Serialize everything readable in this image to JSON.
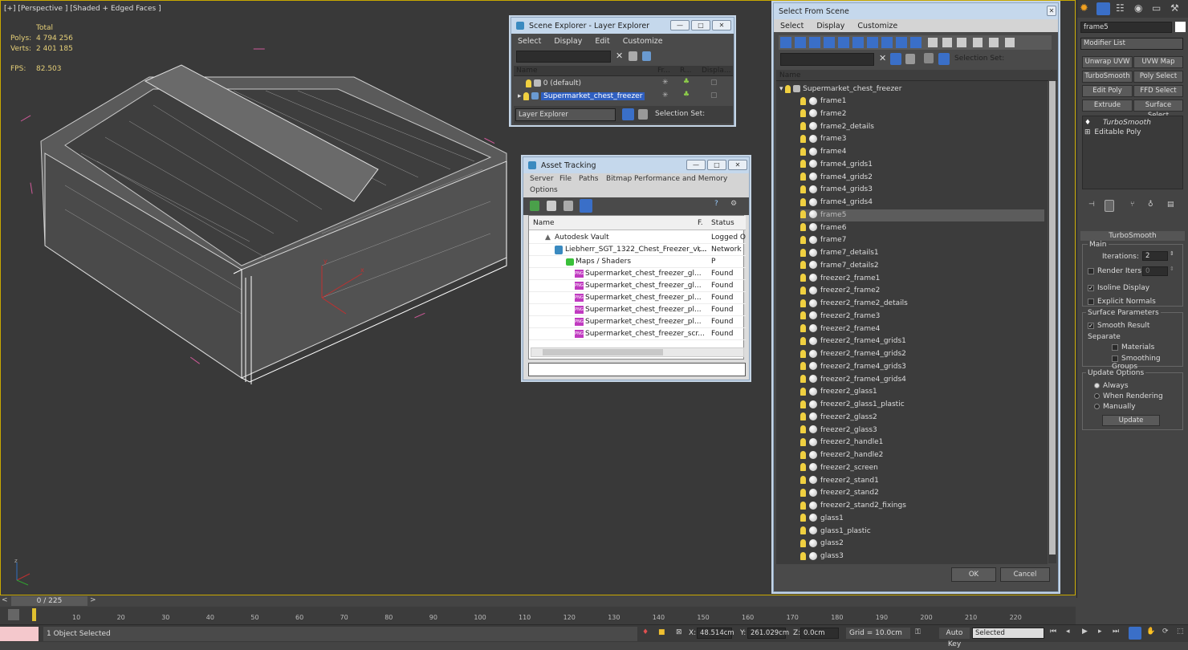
{
  "viewport": {
    "label": "[+] [Perspective ] [Shaded + Edged Faces ]",
    "stats_total": "Total",
    "polys_label": "Polys:",
    "polys": "4 794 256",
    "verts_label": "Verts:",
    "verts": "2 401 185",
    "fps_label": "FPS:",
    "fps": "82.503",
    "axis_x": "x",
    "axis_y": "y",
    "axis_z": "z"
  },
  "scene_explorer": {
    "title": "Scene Explorer - Layer Explorer",
    "menu": [
      "Select",
      "Display",
      "Edit",
      "Customize"
    ],
    "columns": [
      "Name",
      "Fr...",
      "R...",
      "Displa..."
    ],
    "rows": [
      "0 (default)",
      "Supermarket_chest_freezer"
    ],
    "footer_combo": "Layer Explorer",
    "selection_set": "Selection Set:"
  },
  "asset_tracking": {
    "title": "Asset Tracking",
    "menu": [
      "Server",
      "File",
      "Paths",
      "Bitmap Performance and Memory"
    ],
    "menu2": "Options",
    "columns": [
      "Name",
      "F.",
      "Status"
    ],
    "rows": [
      {
        "name": "Autodesk Vault",
        "f": "",
        "status": "Logged O"
      },
      {
        "name": "Liebherr_SGT_1322_Chest_Freezer_vr...",
        "f": "\\...",
        "status": "Network P"
      },
      {
        "name": "Maps / Shaders",
        "f": "",
        "status": ""
      },
      {
        "name": "Supermarket_chest_freezer_gl...",
        "f": "",
        "status": "Found"
      },
      {
        "name": "Supermarket_chest_freezer_gl...",
        "f": "",
        "status": "Found"
      },
      {
        "name": "Supermarket_chest_freezer_pl...",
        "f": "",
        "status": "Found"
      },
      {
        "name": "Supermarket_chest_freezer_pl...",
        "f": "",
        "status": "Found"
      },
      {
        "name": "Supermarket_chest_freezer_pl...",
        "f": "",
        "status": "Found"
      },
      {
        "name": "Supermarket_chest_freezer_scr...",
        "f": "",
        "status": "Found"
      }
    ],
    "png_tag": "PNG"
  },
  "select_from_scene": {
    "title": "Select From Scene",
    "menu": [
      "Select",
      "Display",
      "Customize"
    ],
    "selection_set": "Selection Set:",
    "column": "Name",
    "root": "Supermarket_chest_freezer",
    "items": [
      "frame1",
      "frame2",
      "frame2_details",
      "frame3",
      "frame4",
      "frame4_grids1",
      "frame4_grids2",
      "frame4_grids3",
      "frame4_grids4",
      "frame5",
      "frame6",
      "frame7",
      "frame7_details1",
      "frame7_details2",
      "freezer2_frame1",
      "freezer2_frame2",
      "freezer2_frame2_details",
      "freezer2_frame3",
      "freezer2_frame4",
      "freezer2_frame4_grids1",
      "freezer2_frame4_grids2",
      "freezer2_frame4_grids3",
      "freezer2_frame4_grids4",
      "freezer2_glass1",
      "freezer2_glass1_plastic",
      "freezer2_glass2",
      "freezer2_glass3",
      "freezer2_handle1",
      "freezer2_handle2",
      "freezer2_screen",
      "freezer2_stand1",
      "freezer2_stand2",
      "freezer2_stand2_fixings",
      "glass1",
      "glass1_plastic",
      "glass2",
      "glass3"
    ],
    "selected_item": "frame5",
    "ok": "OK",
    "cancel": "Cancel"
  },
  "command_panel": {
    "object_name": "frame5",
    "modifier_list": "Modifier List",
    "buttons": [
      "Unwrap UVW",
      "UVW Map",
      "TurboSmooth",
      "Poly Select",
      "Edit Poly",
      "FFD Select",
      "Extrude",
      "Surface Select"
    ],
    "stack": [
      "TurboSmooth",
      "Editable Poly"
    ],
    "rollout_title": "TurboSmooth",
    "main_label": "Main",
    "iterations_label": "Iterations:",
    "iterations": "2",
    "render_iters_label": "Render Iters:",
    "render_iters": "0",
    "isoline": "Isoline Display",
    "explicit_normals": "Explicit Normals",
    "surface_params": "Surface Parameters",
    "smooth_result": "Smooth Result",
    "separate": "Separate",
    "materials": "Materials",
    "smoothing_groups": "Smoothing Groups",
    "update_options": "Update Options",
    "always": "Always",
    "when_rendering": "When Rendering",
    "manually": "Manually",
    "update": "Update"
  },
  "timeline": {
    "frame_counter": "0 / 225",
    "ticks": [
      "10",
      "20",
      "30",
      "40",
      "50",
      "60",
      "70",
      "80",
      "90",
      "100",
      "110",
      "120",
      "130",
      "140",
      "150",
      "160",
      "170",
      "180",
      "190",
      "200",
      "210",
      "220"
    ]
  },
  "status_bar": {
    "selected": "1 Object Selected",
    "x_label": "X:",
    "x": "48.514cm",
    "y_label": "Y:",
    "y": "261.029cm",
    "z_label": "Z:",
    "z": "0.0cm",
    "grid": "Grid = 10.0cm",
    "auto_key": "Auto Key",
    "key_mode": "Selected"
  },
  "colors": {
    "accent_selection": "#3a6fc8",
    "stats": "#e6d078",
    "bbox": "#d0509a"
  }
}
